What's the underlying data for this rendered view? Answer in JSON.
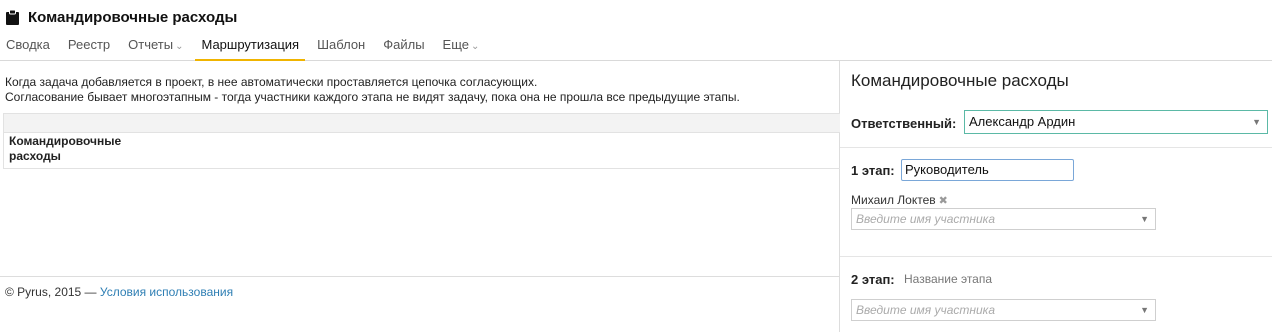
{
  "header": {
    "title": "Командировочные расходы",
    "icon": "clipboard-icon",
    "tabs": [
      {
        "label": "Сводка",
        "active": false,
        "dropdown": false
      },
      {
        "label": "Реестр",
        "active": false,
        "dropdown": false
      },
      {
        "label": "Отчеты",
        "active": false,
        "dropdown": true
      },
      {
        "label": "Маршрутизация",
        "active": true,
        "dropdown": false
      },
      {
        "label": "Шаблон",
        "active": false,
        "dropdown": false
      },
      {
        "label": "Файлы",
        "active": false,
        "dropdown": false
      },
      {
        "label": "Еще",
        "active": false,
        "dropdown": true
      }
    ],
    "active_tab_color": "#f0b400"
  },
  "main": {
    "info_line1": "Когда задача добавляется в проект, в нее автоматически проставляется цепочка согласующих.",
    "info_line2": "Согласование бывает многоэтапным - тогда участники каждого этапа не видят задачу, пока она не прошла все предыдущие этапы.",
    "route_table": {
      "process_name": "Командировочные расходы"
    }
  },
  "footer": {
    "copyright": "© Pyrus, 2015 — ",
    "terms_link": "Условия использования",
    "link_color": "#2f7fb4"
  },
  "panel": {
    "title": "Командировочные расходы",
    "responsible_label": "Ответственный:",
    "responsible_value": "Александр Ардин",
    "stage1": {
      "label": "1 этап:",
      "name_value": "Руководитель",
      "participants": [
        "Михаил Локтев"
      ],
      "participant_placeholder": "Введите имя участника"
    },
    "stage2": {
      "label": "2 этап:",
      "name_placeholder": "Название этапа",
      "participant_placeholder": "Введите имя участника"
    },
    "accent_color": "#5bb9a6"
  }
}
